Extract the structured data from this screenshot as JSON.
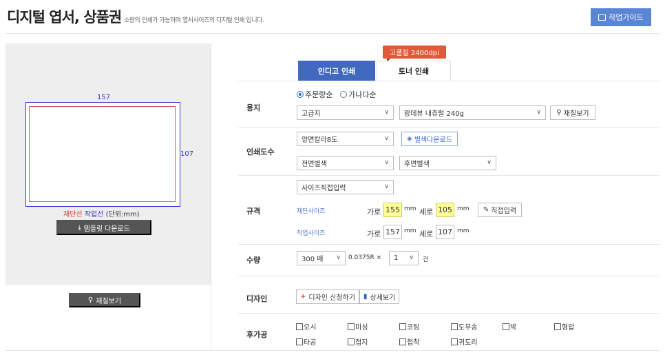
{
  "header": {
    "title": "디지털 엽서, 상품권",
    "subtitle": "소량의 인쇄가 가능하며 엽서사이즈의 디지털 인쇄 입니다.",
    "guide_button": "작업가이드"
  },
  "preview": {
    "work_width": "157",
    "work_height": "107",
    "legend_cut": "재단선",
    "legend_work": "작업선",
    "legend_unit": "(단위:mm)",
    "template_button": "템플릿 다운로드",
    "paper_button": "재질보기"
  },
  "tabs": {
    "badge": "고품질 2400dpi",
    "indigo": "인디고 인쇄",
    "toner": "토너 인쇄"
  },
  "paper": {
    "label": "용지",
    "radio_popular": "주문량순",
    "radio_alpha": "가나다순",
    "type_value": "고급지",
    "stock_value": "랑데뷰 내츄럴 240g",
    "view_button": "재질보기"
  },
  "print": {
    "label": "인쇄도수",
    "color_value": "양면칼라8도",
    "download_button": "별색다운로드",
    "front_value": "전면별색",
    "back_value": "후면별색"
  },
  "size": {
    "label": "규격",
    "mode_value": "사이즈직접입력",
    "cut_label": "재단사이즈",
    "work_label": "작업사이즈",
    "width_label": "가로",
    "height_label": "세로",
    "unit": "mm",
    "cut_width": "155",
    "cut_height": "105",
    "work_width": "157",
    "work_height": "107",
    "direct_button": "직접입력"
  },
  "qty": {
    "label": "수량",
    "value": "300 매",
    "rate": "0.0375R ×",
    "count": "1",
    "unit": "건"
  },
  "design": {
    "label": "디자인",
    "apply_button": "디자인 신청하기",
    "detail_button": "상세보기"
  },
  "post": {
    "label": "후가공",
    "options": [
      "오시",
      "미싱",
      "코팅",
      "도무송",
      "박",
      "형압",
      "타공",
      "접지",
      "접착",
      "귀도리"
    ]
  }
}
